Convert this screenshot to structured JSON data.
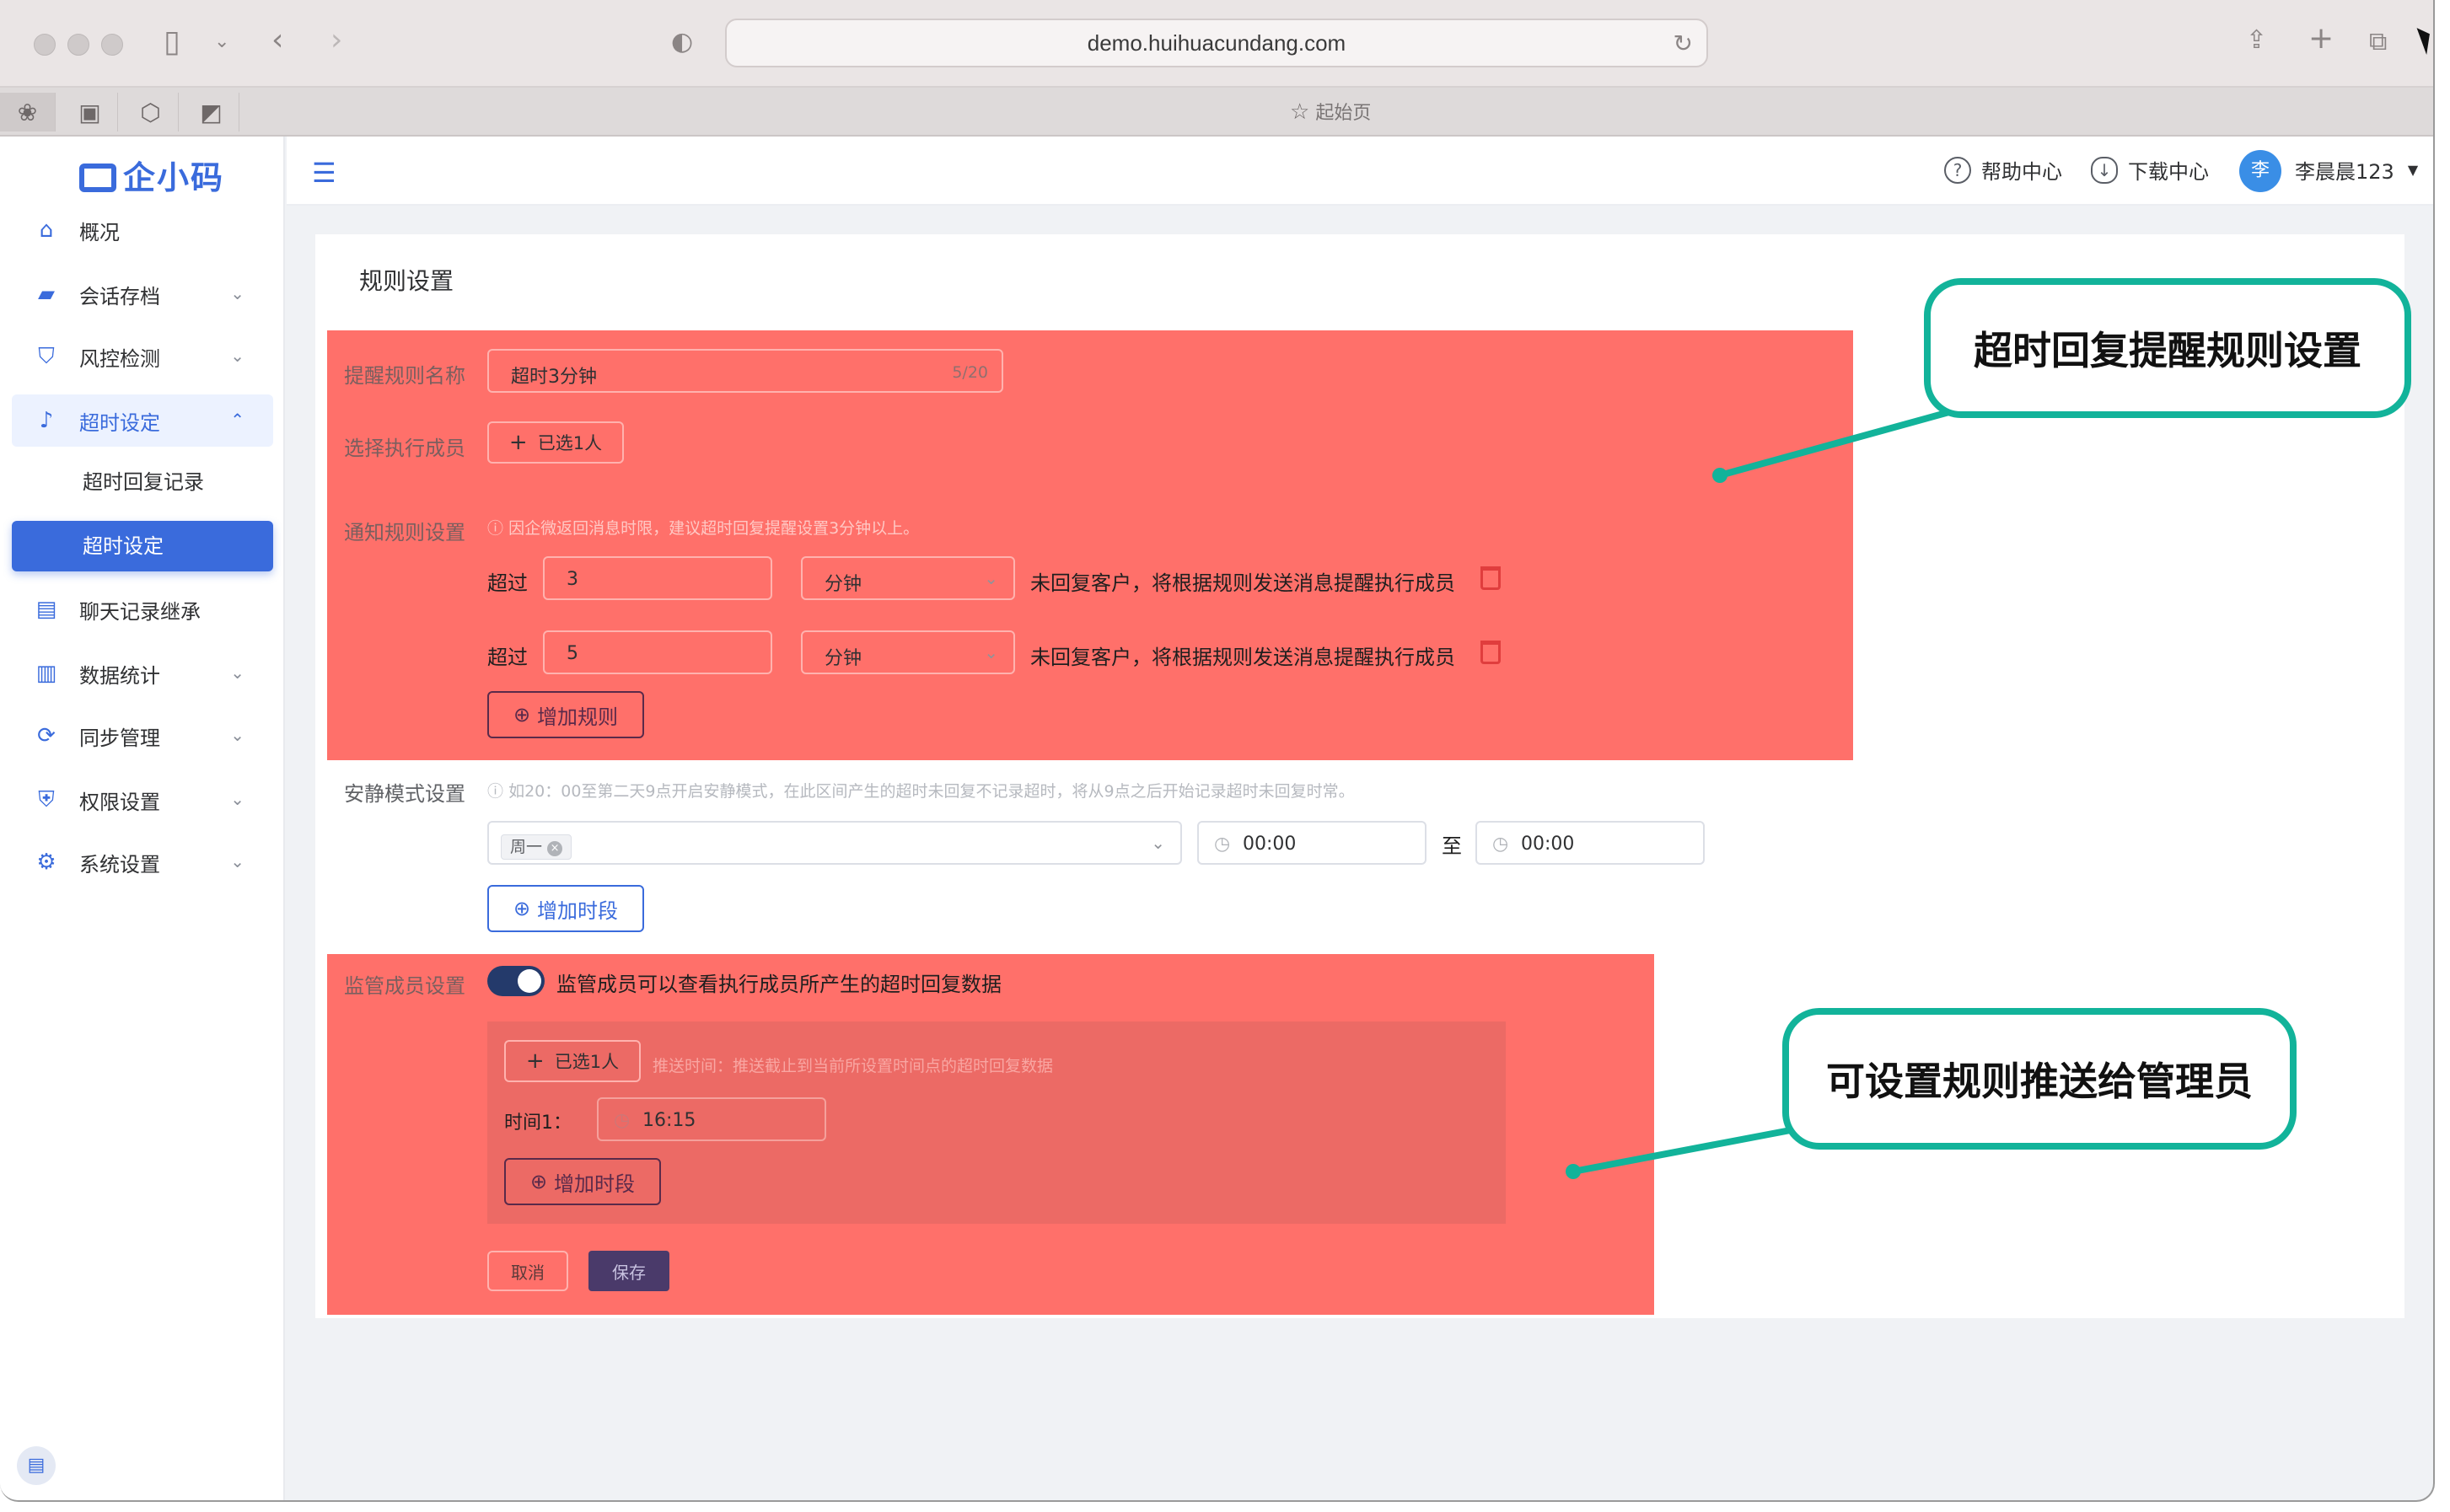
{
  "browser": {
    "url": "demo.huihuacundang.com",
    "tab_title": "起始页"
  },
  "sidebar": {
    "logo": "企小码",
    "items": [
      {
        "label": "概况",
        "icon": "home-icon"
      },
      {
        "label": "会话存档",
        "icon": "folder-icon"
      },
      {
        "label": "风控检测",
        "icon": "shield-icon"
      },
      {
        "label": "超时设定",
        "icon": "bell-icon"
      },
      {
        "label": "聊天记录继承",
        "icon": "chat-icon"
      },
      {
        "label": "数据统计",
        "icon": "bar-chart-icon"
      },
      {
        "label": "同步管理",
        "icon": "sync-icon"
      },
      {
        "label": "权限设置",
        "icon": "lock-shield-icon"
      },
      {
        "label": "系统设置",
        "icon": "gear-icon"
      }
    ],
    "sub_items": [
      "超时回复记录",
      "超时设定"
    ]
  },
  "header": {
    "help": "帮助中心",
    "download": "下载中心",
    "avatar_text": "李",
    "username": "李晨晨123"
  },
  "page": {
    "title": "规则设置",
    "rule_name_label": "提醒规则名称",
    "rule_name_value": "超时3分钟",
    "rule_name_count": "5/20",
    "members_label": "选择执行成员",
    "members_button": "已选1人",
    "notify_label": "通知规则设置",
    "notify_hint": "因企微返回消息时限，建议超时回复提醒设置3分钟以上。",
    "rules": [
      {
        "prefix": "超过",
        "value": "3",
        "unit": "分钟",
        "suffix": "未回复客户，将根据规则发送消息提醒执行成员"
      },
      {
        "prefix": "超过",
        "value": "5",
        "unit": "分钟",
        "suffix": "未回复客户，将根据规则发送消息提醒执行成员"
      }
    ],
    "add_rule": "增加规则",
    "quiet_label": "安静模式设置",
    "quiet_hint": "如20：00至第二天9点开启安静模式，在此区间产生的超时未回复不记录超时，将从9点之后开始记录超时未回复时常。",
    "quiet_day_tag": "周一",
    "quiet_start": "00:00",
    "quiet_to": "至",
    "quiet_end": "00:00",
    "add_period": "增加时段",
    "supervisor_label": "监管成员设置",
    "supervisor_toggle_text": "监管成员可以查看执行成员所产生的超时回复数据",
    "supervisor_button": "已选1人",
    "push_hint": "推送时间：推送截止到当前所设置时间点的超时回复数据",
    "time_label": "时间1：",
    "time_value": "16:15",
    "add_period_2": "增加时段",
    "cancel": "取消",
    "save": "保存"
  },
  "callouts": {
    "top": "超时回复提醒规则设置",
    "bottom": "可设置规则推送给管理员"
  },
  "colors": {
    "accent": "#3a6bdc",
    "highlight": "#ff706a",
    "callout_border": "#12b39a"
  }
}
